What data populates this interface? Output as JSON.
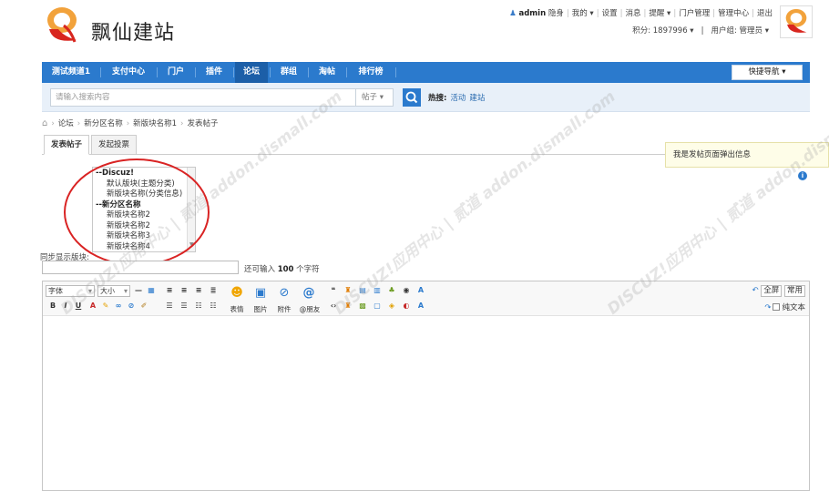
{
  "header": {
    "site_name": "飘仙建站",
    "user_name": "admin",
    "top_links": [
      "隐身",
      "我的 ▾",
      "设置",
      "消息",
      "提醒 ▾",
      "门户管理",
      "管理中心",
      "退出"
    ],
    "points_label": "积分: 1897996 ▾",
    "user_group_label": "用户组: 管理员 ▾"
  },
  "nav": {
    "items": [
      "测试频道1",
      "支付中心",
      "门户",
      "插件",
      "论坛",
      "群组",
      "淘帖",
      "排行榜"
    ],
    "active": "论坛",
    "quick_nav": "快捷导航 ▾"
  },
  "search": {
    "placeholder": "请输入搜索内容",
    "type": "帖子 ▾",
    "hot_label": "热搜:",
    "hot_links": [
      "活动",
      "建站"
    ]
  },
  "breadcrumb": [
    "论坛",
    "新分区名称",
    "新版块名称1",
    "发表帖子"
  ],
  "tabs": [
    "发表帖子",
    "发起投票"
  ],
  "tooltip": "我是发帖页面弹出信息",
  "info_icon_text": "i",
  "forum_select": {
    "options": [
      {
        "label": "--Discuz!",
        "type": "group"
      },
      {
        "label": "默认版块(主题分类)",
        "type": "child"
      },
      {
        "label": "新版块名称(分类信息)",
        "type": "child"
      },
      {
        "label": "--新分区名称",
        "type": "group"
      },
      {
        "label": "新版块名称2",
        "type": "child"
      },
      {
        "label": "新版块名称2",
        "type": "child"
      },
      {
        "label": "新版块名称3",
        "type": "child"
      },
      {
        "label": "新版块名称4",
        "type": "child"
      }
    ],
    "sync_label": "同步显示版块:"
  },
  "title_field": {
    "remain_prefix": "还可输入",
    "remain_count": "100",
    "remain_suffix": "个字符"
  },
  "editor": {
    "font_select": "字体",
    "size_select": "大小",
    "big_buttons": [
      "表情",
      "图片",
      "附件",
      "@朋友"
    ],
    "fullscreen": "全屏",
    "common": "常用",
    "plain_text": "纯文本"
  },
  "watermark": "DISCUZ!应用中心 | 贰道  addon.dismall.com",
  "colors": {
    "nav_bg": "#2b7acd",
    "nav_active": "#1c5fa8",
    "search_bg": "#e8f0f9",
    "circle": "#d92323",
    "tooltip_bg": "#fefde8"
  }
}
